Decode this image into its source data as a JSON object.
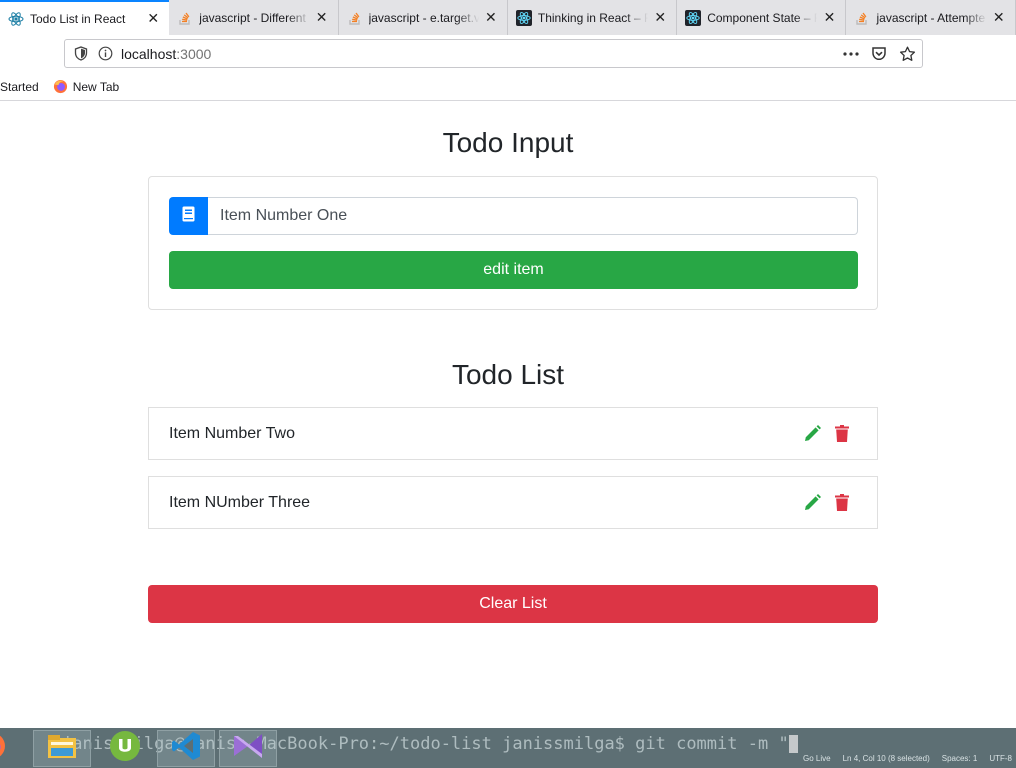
{
  "browser": {
    "tabs": [
      {
        "title": "Todo List in React",
        "icon": "react-icon",
        "active": true
      },
      {
        "title": "javascript - Different",
        "icon": "stackoverflow-icon",
        "active": false
      },
      {
        "title": "javascript - e.target.v",
        "icon": "stackoverflow-icon",
        "active": false
      },
      {
        "title": "Thinking in React – R",
        "icon": "react-icon",
        "active": false
      },
      {
        "title": "Component State – R",
        "icon": "react-icon",
        "active": false
      },
      {
        "title": "javascript - Attempte",
        "icon": "stackoverflow-icon",
        "active": false
      }
    ],
    "url_host": "localhost",
    "url_port": ":3000",
    "bookmarks": [
      {
        "label": "Started",
        "icon": ""
      },
      {
        "label": "New Tab",
        "icon": "firefox-icon"
      }
    ]
  },
  "page": {
    "input_heading": "Todo Input",
    "input_value": "Item Number One",
    "edit_button_label": "edit item",
    "list_heading": "Todo List",
    "items": [
      {
        "text": "Item Number Two"
      },
      {
        "text": "Item NUmber Three"
      }
    ],
    "clear_button_label": "Clear List"
  },
  "taskbar": {
    "terminal_text": "janissmilga@Janiss-MacBook-Pro:~/todo-list janissmilga$ git commit -m \"",
    "status_items": [
      "Go Live",
      "Ln 4, Col 10 (8 selected)",
      "Spaces: 1",
      "UTF-8"
    ]
  },
  "colors": {
    "primary": "#007bff",
    "success": "#28a745",
    "danger": "#dc3545",
    "tab_accent": "#0a84ff"
  }
}
